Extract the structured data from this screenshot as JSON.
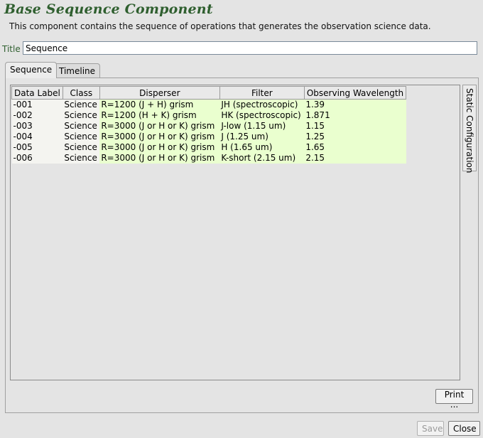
{
  "header": {
    "title": "Base Sequence Component",
    "description": "This component contains the sequence of operations that generates the observation science data."
  },
  "title_field": {
    "label": "Title",
    "value": "Sequence"
  },
  "tabs": [
    {
      "label": "Sequence",
      "selected": true
    },
    {
      "label": "Timeline",
      "selected": false
    }
  ],
  "table": {
    "columns": [
      "Data Label",
      "Class",
      "Disperser",
      "Filter",
      "Observing Wavelength"
    ],
    "rows": [
      [
        "-001",
        "Science",
        "R=1200 (J + H) grism",
        "JH (spectroscopic)",
        "1.39"
      ],
      [
        "-002",
        "Science",
        "R=1200 (H + K) grism",
        "HK (spectroscopic)",
        "1.871"
      ],
      [
        "-003",
        "Science",
        "R=3000 (J or H or K) grism",
        "J-low (1.15 um)",
        "1.15"
      ],
      [
        "-004",
        "Science",
        "R=3000 (J or H or K) grism",
        "J (1.25 um)",
        "1.25"
      ],
      [
        "-005",
        "Science",
        "R=3000 (J or H or K) grism",
        "H (1.65 um)",
        "1.65"
      ],
      [
        "-006",
        "Science",
        "R=3000 (J or H or K) grism",
        "K-short (2.15 um)",
        "2.15"
      ]
    ]
  },
  "side_tab": {
    "label": "Static Configuration"
  },
  "buttons": {
    "print": "Print ...",
    "save": "Save",
    "close": "Close"
  },
  "colors": {
    "title_green": "#2f5f2f",
    "cell_highlight": "#eaffcf"
  }
}
